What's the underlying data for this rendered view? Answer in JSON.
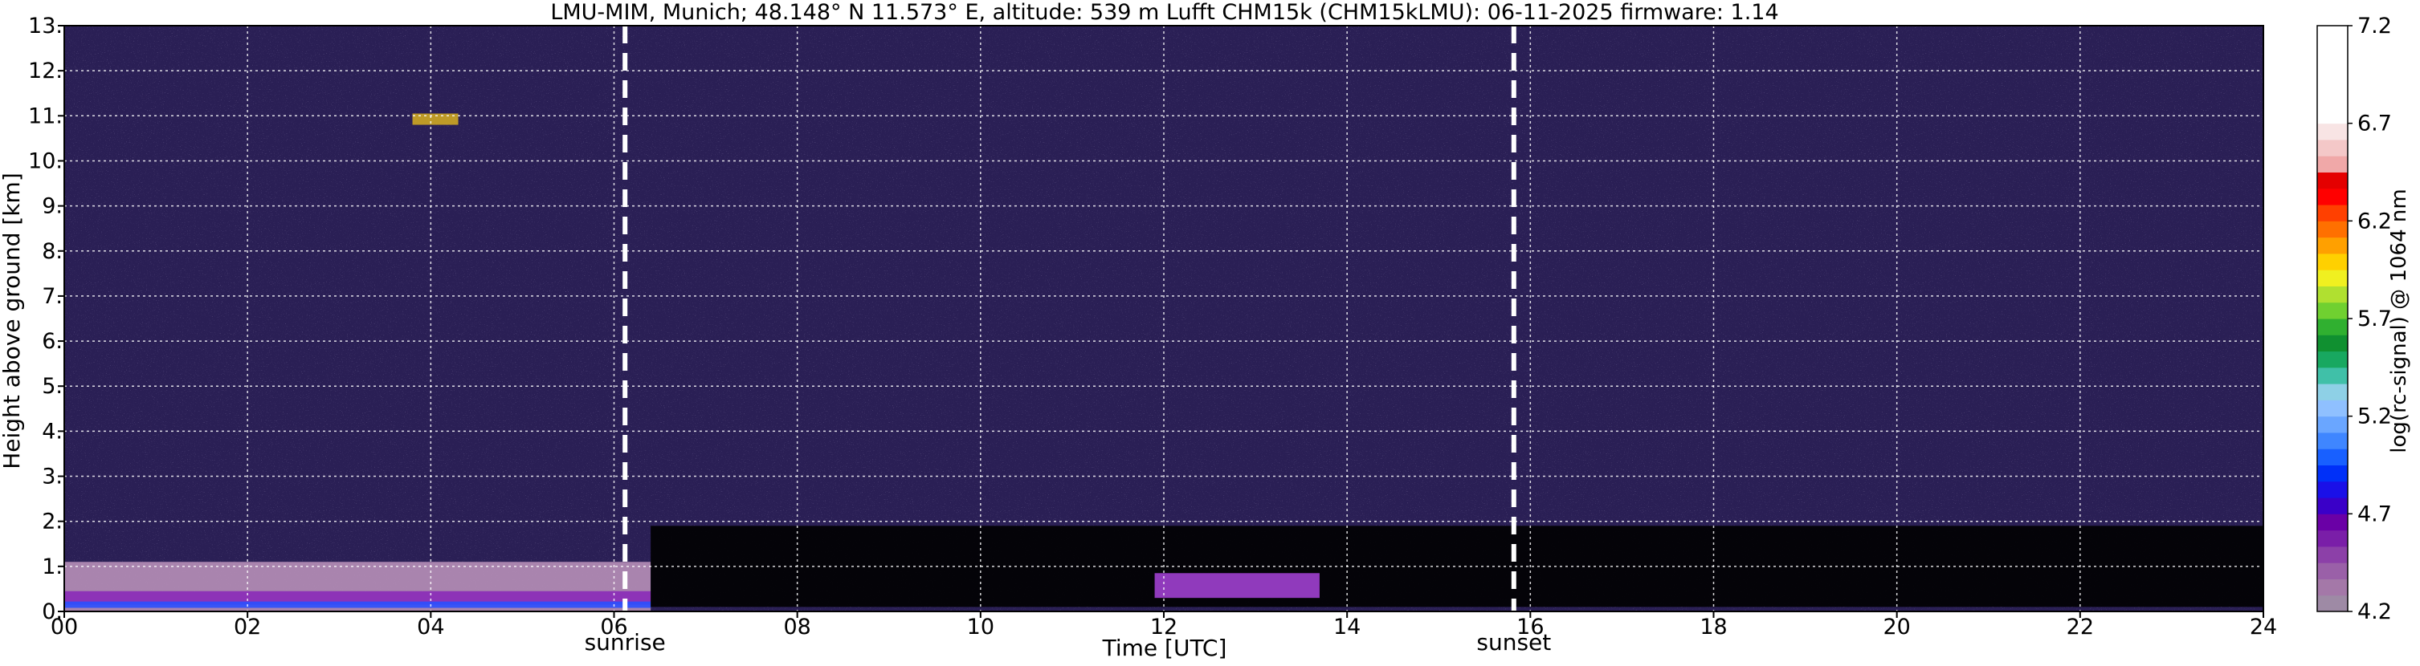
{
  "chart_data": {
    "type": "heatmap",
    "title": "LMU-MIM, Munich; 48.148° N 11.573° E, altitude: 539 m    Lufft CHM15k (CHM15kLMU): 06-11-2025    firmware: 1.14",
    "xlabel": "Time [UTC]",
    "ylabel": "Height above ground [km]",
    "xlim": [
      0,
      24
    ],
    "ylim": [
      0,
      13
    ],
    "x_ticks": [
      0,
      2,
      4,
      6,
      8,
      10,
      12,
      14,
      16,
      18,
      20,
      22,
      24
    ],
    "x_tick_labels": [
      "00",
      "02",
      "04",
      "06",
      "08",
      "10",
      "12",
      "14",
      "16",
      "18",
      "20",
      "22",
      "24"
    ],
    "y_ticks": [
      0,
      1,
      2,
      3,
      4,
      5,
      6,
      7,
      8,
      9,
      10,
      11,
      12,
      13
    ],
    "y_tick_labels": [
      "0.",
      "1.",
      "2.",
      "3.",
      "4.",
      "5.",
      "6.",
      "7.",
      "8.",
      "9.",
      "10.",
      "11.",
      "12.",
      "13."
    ],
    "grid": true,
    "background_color": "#2a1f55",
    "events": [
      {
        "label": "sunrise",
        "time": 6.12
      },
      {
        "label": "sunset",
        "time": 15.82
      }
    ],
    "features": [
      {
        "name": "boundary-layer",
        "t_start": 0,
        "t_end": 6.4,
        "h_bottom": 0,
        "h_top": 1.1,
        "color": "#b78fb8"
      },
      {
        "name": "aerosol-core",
        "t_start": 0,
        "t_end": 6.4,
        "h_bottom": 0.15,
        "h_top": 0.45,
        "color": "#8a2ab8"
      },
      {
        "name": "blue-band",
        "t_start": 0,
        "t_end": 6.4,
        "h_bottom": 0.08,
        "h_top": 0.22,
        "color": "#2a50ff"
      },
      {
        "name": "daytime-low-noise",
        "t_start": 6.4,
        "t_end": 24,
        "h_bottom": 0.1,
        "h_top": 1.9,
        "color": "#000000"
      },
      {
        "name": "cloud",
        "t_start": 3.8,
        "t_end": 4.3,
        "h_bottom": 10.8,
        "h_top": 11.05,
        "color": "#d8b020"
      },
      {
        "name": "midday-layer",
        "t_start": 11.9,
        "t_end": 13.7,
        "h_bottom": 0.3,
        "h_top": 0.85,
        "color": "#a040d0"
      }
    ],
    "colorbar": {
      "label": "log(rc-signal) @ 1064 nm",
      "min": 4.2,
      "max": 7.2,
      "tick_values": [
        4.2,
        4.7,
        5.2,
        5.7,
        6.2,
        6.7,
        7.2
      ],
      "tick_labels": [
        "4.2",
        "4.7",
        "5.2",
        "5.7",
        "6.2",
        "6.7",
        "7.2"
      ],
      "colors": [
        "#9e8aa5",
        "#a478a8",
        "#9a60a8",
        "#8c40a8",
        "#7a1ea8",
        "#6a00a6",
        "#3a00c8",
        "#1a10e8",
        "#0030f8",
        "#1860ff",
        "#3f86ff",
        "#6aa6ff",
        "#8fc0ff",
        "#8ed0e6",
        "#40c0a8",
        "#18a860",
        "#109030",
        "#30b030",
        "#70d030",
        "#b0e030",
        "#f0f020",
        "#ffd000",
        "#ffa000",
        "#ff7000",
        "#ff4000",
        "#ff0000",
        "#e40000",
        "#f0a8a8",
        "#f4c8c8",
        "#f8e4e4",
        "#ffffff",
        "#ffffff",
        "#ffffff",
        "#ffffff",
        "#ffffff",
        "#ffffff"
      ]
    }
  }
}
